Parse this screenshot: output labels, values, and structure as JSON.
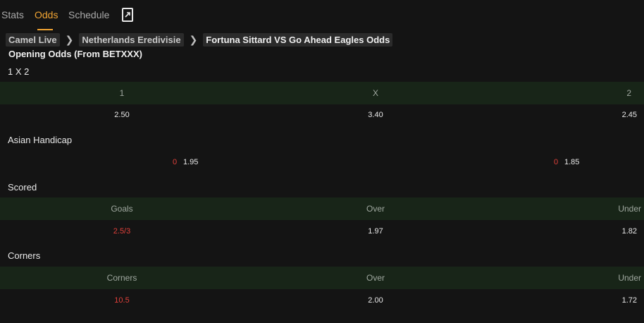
{
  "tabs": [
    {
      "label": "Stats"
    },
    {
      "label": "Odds"
    },
    {
      "label": "Schedule"
    }
  ],
  "breadcrumb": [
    "Camel Live",
    "Netherlands Eredivisie",
    "Fortuna Sittard VS Go Ahead Eagles Odds"
  ],
  "opening_title": "Opening Odds (From BETXXX)",
  "sections": {
    "x12": {
      "title": "1 X 2",
      "headers": [
        "1",
        "X",
        "2"
      ],
      "values": [
        "2.50",
        "3.40",
        "2.45"
      ]
    },
    "asian": {
      "title": "Asian Handicap",
      "home_line": "0",
      "home_odds": "1.95",
      "away_line": "0",
      "away_odds": "1.85"
    },
    "scored": {
      "title": "Scored",
      "headers": [
        "Goals",
        "Over",
        "Under"
      ],
      "values": [
        "2.5/3",
        "1.97",
        "1.82"
      ]
    },
    "corners": {
      "title": "Corners",
      "headers": [
        "Corners",
        "Over",
        "Under"
      ],
      "values": [
        "10.5",
        "2.00",
        "1.72"
      ]
    }
  },
  "colors": {
    "accent": "#f2a533",
    "header_row_bg": "#182518",
    "negative": "#e0403a",
    "background": "#141414"
  },
  "icons": {
    "share": "share-external-icon",
    "separator": "chevron-right-icon"
  }
}
